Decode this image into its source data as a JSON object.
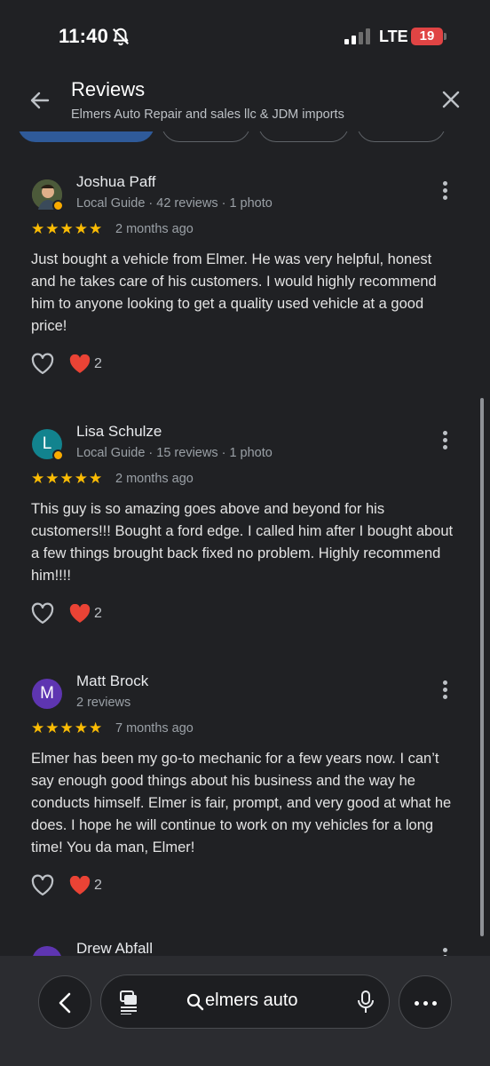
{
  "status_bar": {
    "time": "11:40",
    "network": "LTE",
    "battery": "19"
  },
  "header": {
    "title": "Reviews",
    "subtitle": "Elmers Auto Repair and sales llc & JDM imports"
  },
  "reviews": [
    {
      "author": "Joshua Paff",
      "meta": "Local Guide · 42 reviews · 1 photo",
      "rating": 5,
      "stars": "★★★★★",
      "time_ago": "2 months ago",
      "text": "Just bought a vehicle from Elmer. He was very helpful, honest and he takes care of his customers. I would highly recommend him to anyone looking to get a quality used vehicle at a good price!",
      "reaction_count": "2"
    },
    {
      "author": "Lisa Schulze",
      "avatar_letter": "L",
      "avatar_color": "#12838e",
      "meta": "Local Guide · 15 reviews · 1 photo",
      "rating": 5,
      "stars": "★★★★★",
      "time_ago": "2 months ago",
      "text": "This guy is so amazing goes above and beyond for his customers!!! Bought a ford edge. I called him after I bought about a few things brought back fixed no problem. Highly recommend him!!!!",
      "reaction_count": "2"
    },
    {
      "author": "Matt Brock",
      "avatar_letter": "M",
      "avatar_color": "#5e35b1",
      "meta": "2 reviews",
      "rating": 5,
      "stars": "★★★★★",
      "time_ago": "7 months ago",
      "text": "Elmer has been my go-to mechanic for a few years now. I can’t say enough good things about his business and the way he conducts himself. Elmer is fair, prompt, and very good at what he does. I hope he will continue to work on my vehicles for a long time! You da man, Elmer!",
      "reaction_count": "2"
    },
    {
      "author": "Drew Abfall",
      "avatar_color": "#5e35b1"
    }
  ],
  "bottom_bar": {
    "url_text": "elmers auto"
  },
  "colors": {
    "background": "#202124",
    "star": "#fbbc04",
    "heart": "#ea4335",
    "accent_chip": "#2f5a99"
  },
  "icons": [
    "back-arrow-icon",
    "close-icon",
    "more-vert-icon",
    "heart-outline-icon",
    "heart-filled-icon",
    "tabs-icon",
    "search-icon",
    "mic-icon",
    "more-horiz-icon",
    "bell-off-icon",
    "signal-icon"
  ]
}
